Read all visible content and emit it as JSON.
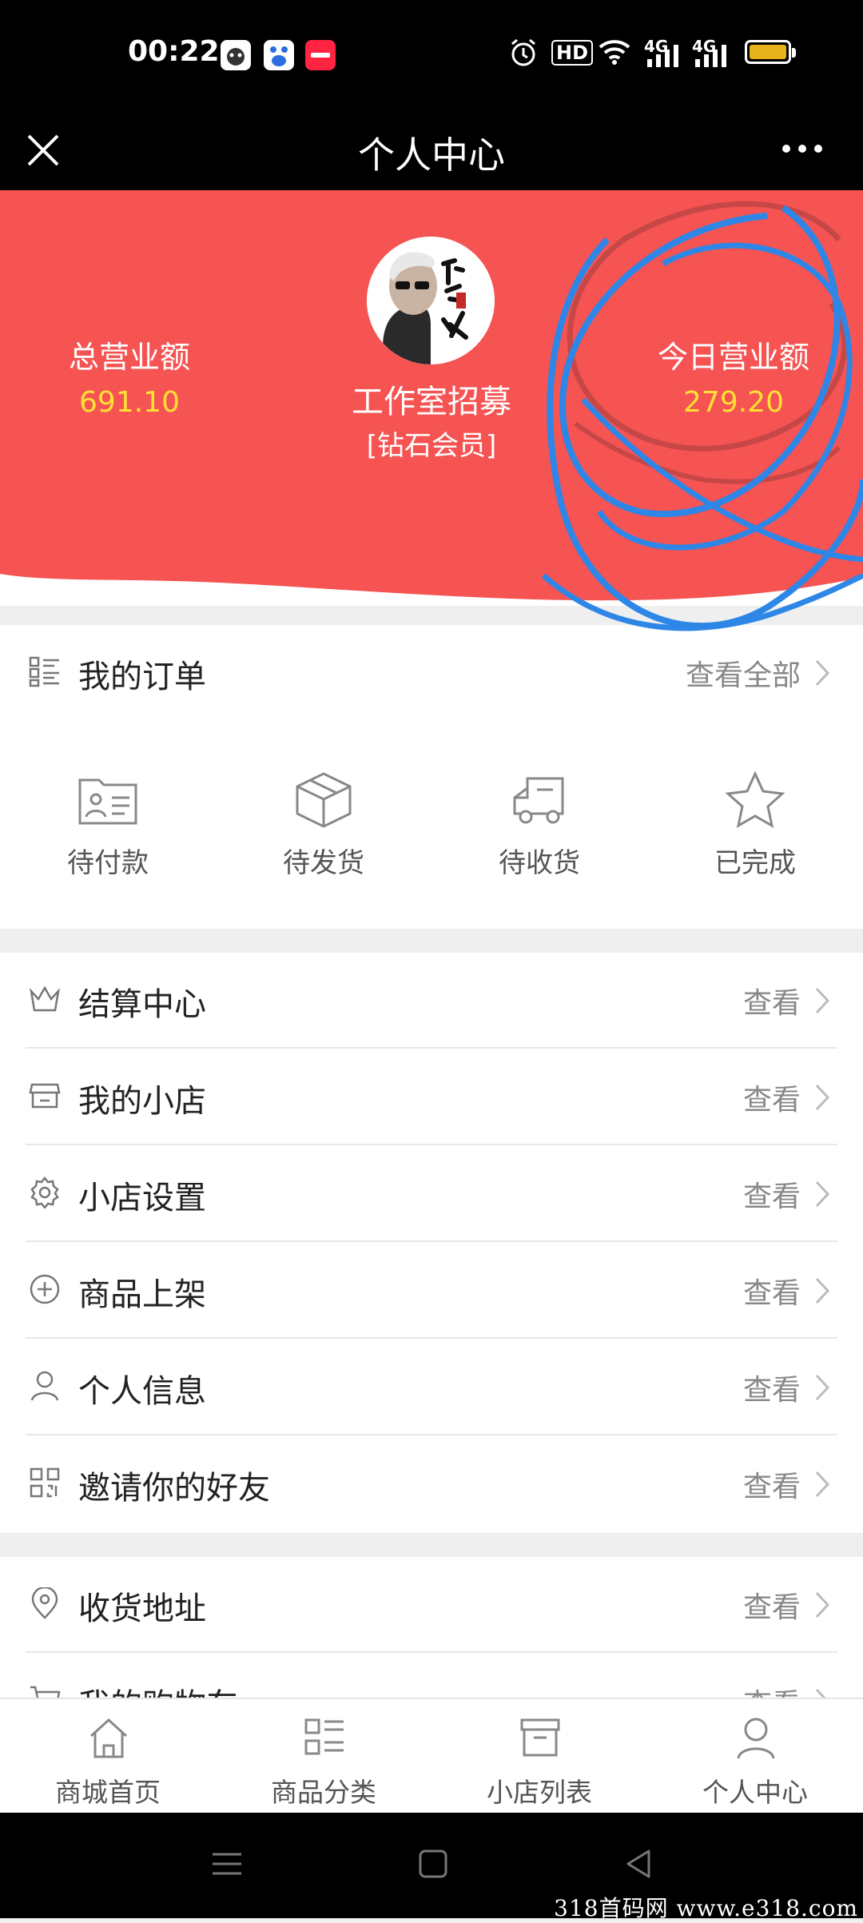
{
  "status_bar": {
    "time": "00:22",
    "notification_icons": [
      "app-icon",
      "baidu-icon",
      "xiaohongshu-icon"
    ],
    "hd_label": "HD",
    "network_1": "4G",
    "network_2": "4G"
  },
  "title_bar": {
    "title": "个人中心"
  },
  "hero": {
    "total_revenue_label": "总营业额",
    "total_revenue_value": "691.10",
    "today_revenue_label": "今日营业额",
    "today_revenue_value": "279.20",
    "profile_name": "工作室招募",
    "member_level": "[钻石会员]",
    "background_color": "#f65353",
    "value_color": "#ffe135"
  },
  "orders": {
    "title": "我的订单",
    "view_all": "查看全部",
    "items": [
      {
        "label": "待付款",
        "icon": "payment-card-icon"
      },
      {
        "label": "待发货",
        "icon": "package-box-icon"
      },
      {
        "label": "待收货",
        "icon": "delivery-truck-icon"
      },
      {
        "label": "已完成",
        "icon": "star-icon"
      }
    ]
  },
  "menu": {
    "items": [
      {
        "label": "结算中心",
        "action": "查看",
        "icon": "crown-icon"
      },
      {
        "label": "我的小店",
        "action": "查看",
        "icon": "shop-icon"
      },
      {
        "label": "小店设置",
        "action": "查看",
        "icon": "gear-icon"
      },
      {
        "label": "商品上架",
        "action": "查看",
        "icon": "plus-circle-icon"
      },
      {
        "label": "个人信息",
        "action": "查看",
        "icon": "person-icon"
      },
      {
        "label": "邀请你的好友",
        "action": "查看",
        "icon": "qr-code-icon"
      }
    ]
  },
  "menu2": {
    "items": [
      {
        "label": "收货地址",
        "action": "查看",
        "icon": "location-pin-icon"
      },
      {
        "label": "我的购物车",
        "action": "查看",
        "icon": "cart-icon"
      }
    ]
  },
  "tab_bar": {
    "items": [
      {
        "label": "商城首页",
        "icon": "home-icon"
      },
      {
        "label": "商品分类",
        "icon": "category-icon"
      },
      {
        "label": "小店列表",
        "icon": "store-box-icon"
      },
      {
        "label": "个人中心",
        "icon": "user-icon"
      }
    ]
  },
  "watermark": "318首码网 www.e318.com"
}
